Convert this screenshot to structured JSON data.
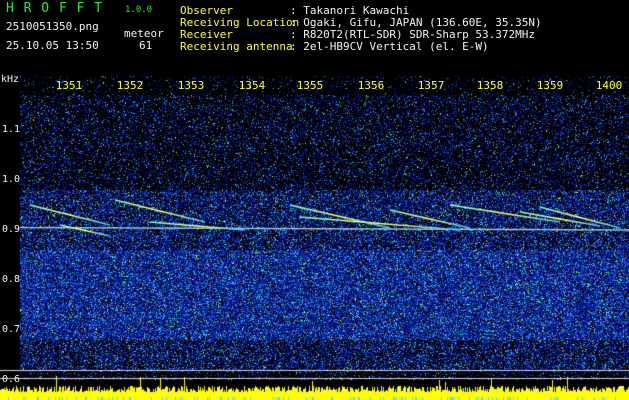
{
  "header": {
    "app_name": "H R O F F T",
    "version": "1.0.0",
    "filename": "2510051350.png",
    "timestamp": "25.10.05 13:50",
    "meteor_label": "meteor",
    "meteor_count": "61",
    "info_labels": [
      "Observer",
      "Receiving Location",
      "Receiver",
      "Receiving antenna"
    ],
    "info_values": [
      ": Takanori Kawachi",
      ": Ogaki, Gifu, JAPAN (136.60E, 35.35N)",
      ": R820T2(RTL-SDR) SDR-Sharp 53.372MHz",
      ": 2el-HB9CV Vertical (el. E-W)"
    ]
  },
  "chart_data": {
    "type": "heatmap",
    "ylabel": "kHz",
    "y_ticks": [
      "1.1",
      "1.0",
      "0.9",
      "0.8",
      "0.7",
      "0.6"
    ],
    "x_ticks": [
      "1351",
      "1352",
      "1353",
      "1354",
      "1355",
      "1356",
      "1357",
      "1358",
      "1359",
      "1400"
    ],
    "colors": {
      "background": "#000000",
      "low": "#0a1a8c",
      "mid": "#2f8fff",
      "high": "#ffff00",
      "label": "#ffff33"
    }
  }
}
